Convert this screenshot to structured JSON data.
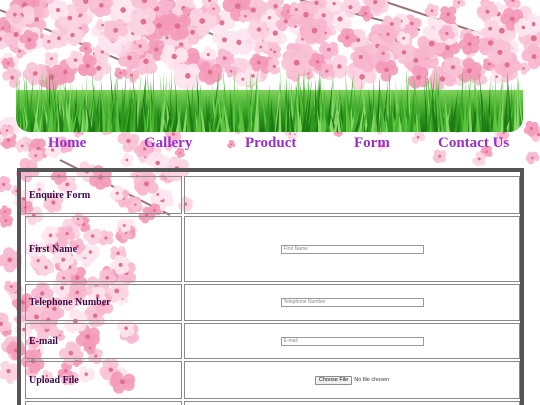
{
  "nav": {
    "items": [
      {
        "label": "Home"
      },
      {
        "label": "Gallery"
      },
      {
        "label": "Product"
      },
      {
        "label": "Form"
      },
      {
        "label": "Contact Us"
      }
    ]
  },
  "form": {
    "title": "Enquire Form",
    "first_name": {
      "label": "First Name",
      "placeholder": "First Name"
    },
    "telephone": {
      "label": "Telephone Number",
      "placeholder": "Telephone Number"
    },
    "email": {
      "label": "E-mail",
      "placeholder": "E-mail"
    },
    "upload": {
      "label": "Upload File",
      "button": "Choose File",
      "status": "No file chosen"
    }
  },
  "colors": {
    "nav_text": "#9b30c8",
    "label_text": "#3c0a46",
    "form_border": "#555555",
    "blossom_pink": "#f7a8c4",
    "grass_green": "#2e9a1e"
  },
  "icons": [
    "cherry-blossom-decoration",
    "grass-banner"
  ]
}
